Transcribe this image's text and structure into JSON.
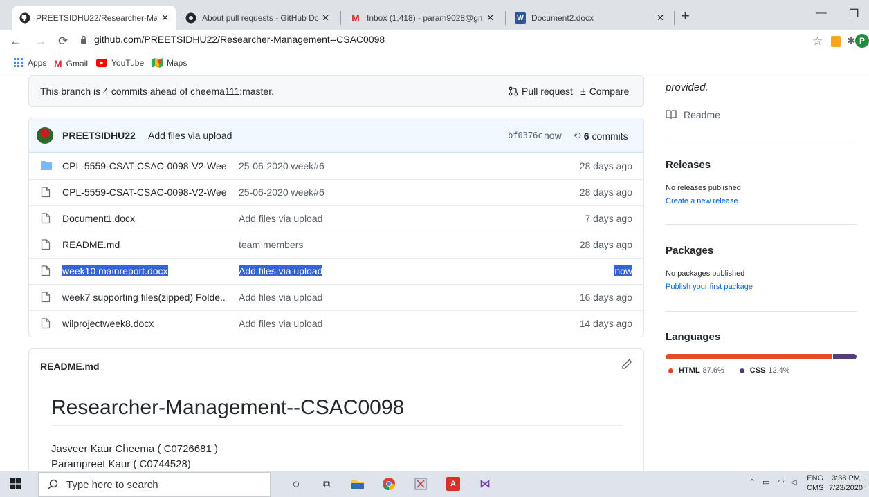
{
  "browser": {
    "tabs": [
      {
        "title": "PREETSIDHU22/Researcher-Mana",
        "favicon": "github-icon",
        "active": true
      },
      {
        "title": "About pull requests - GitHub Doc",
        "favicon": "github-icon",
        "active": false
      },
      {
        "title": "Inbox (1,418) - param9028@gma",
        "favicon": "gmail-icon",
        "active": false
      },
      {
        "title": "Document2.docx",
        "favicon": "word-icon",
        "active": false
      }
    ],
    "url": "github.com/PREETSIDHU22/Researcher-Management--CSAC0098",
    "profile_initial": "P",
    "bookmarks": [
      "Apps",
      "Gmail",
      "YouTube",
      "Maps"
    ]
  },
  "repo": {
    "branch_status": "This branch is 4 commits ahead of cheema111:master.",
    "pull_request_label": "Pull request",
    "compare_label": "Compare",
    "latest_commit": {
      "author": "PREETSIDHU22",
      "message": "Add files via upload",
      "sha": "bf0376c",
      "when": "now",
      "commits_count": "6",
      "commits_label": "commits"
    },
    "files": [
      {
        "type": "folder",
        "name": "CPL-5559-CSAT-CSAC-0098-V2-Wee...",
        "message": "25-06-2020 week#6",
        "age": "28 days ago",
        "selected": false
      },
      {
        "type": "file",
        "name": "CPL-5559-CSAT-CSAC-0098-V2-Wee...",
        "message": "25-06-2020 week#6",
        "age": "28 days ago",
        "selected": false
      },
      {
        "type": "file",
        "name": "Document1.docx",
        "message": "Add files via upload",
        "age": "7 days ago",
        "selected": false
      },
      {
        "type": "file",
        "name": "README.md",
        "message": "team members",
        "age": "28 days ago",
        "selected": false
      },
      {
        "type": "file",
        "name": "week10 mainreport.docx",
        "message": "Add files via upload",
        "age": "now",
        "selected": true
      },
      {
        "type": "file",
        "name": "week7 supporting files(zipped) Folde...",
        "message": "Add files via upload",
        "age": "16 days ago",
        "selected": false
      },
      {
        "type": "file",
        "name": "wilprojectweek8.docx",
        "message": "Add files via upload",
        "age": "14 days ago",
        "selected": false
      }
    ],
    "readme": {
      "filename": "README.md",
      "title": "Researcher-Management--CSAC0098",
      "lines": [
        "Jasveer Kaur Cheema ( C0726681 )",
        "Parampreet Kaur ( C0744528)"
      ]
    }
  },
  "sidebar": {
    "about_tail": "provided.",
    "readme_link": "Readme",
    "releases": {
      "heading": "Releases",
      "status": "No releases published",
      "link": "Create a new release"
    },
    "packages": {
      "heading": "Packages",
      "status": "No packages published",
      "link": "Publish your first package"
    },
    "languages": {
      "heading": "Languages",
      "items": [
        {
          "name": "HTML",
          "percent": "87.6%",
          "value": 87.6,
          "color": "#e34c26"
        },
        {
          "name": "CSS",
          "percent": "12.4%",
          "value": 12.4,
          "color": "#563d7c"
        }
      ]
    }
  },
  "taskbar": {
    "search_placeholder": "Type here to search",
    "lang": "ENG",
    "lang_sub": "CMS",
    "time": "3:38 PM",
    "date": "7/23/2020"
  }
}
